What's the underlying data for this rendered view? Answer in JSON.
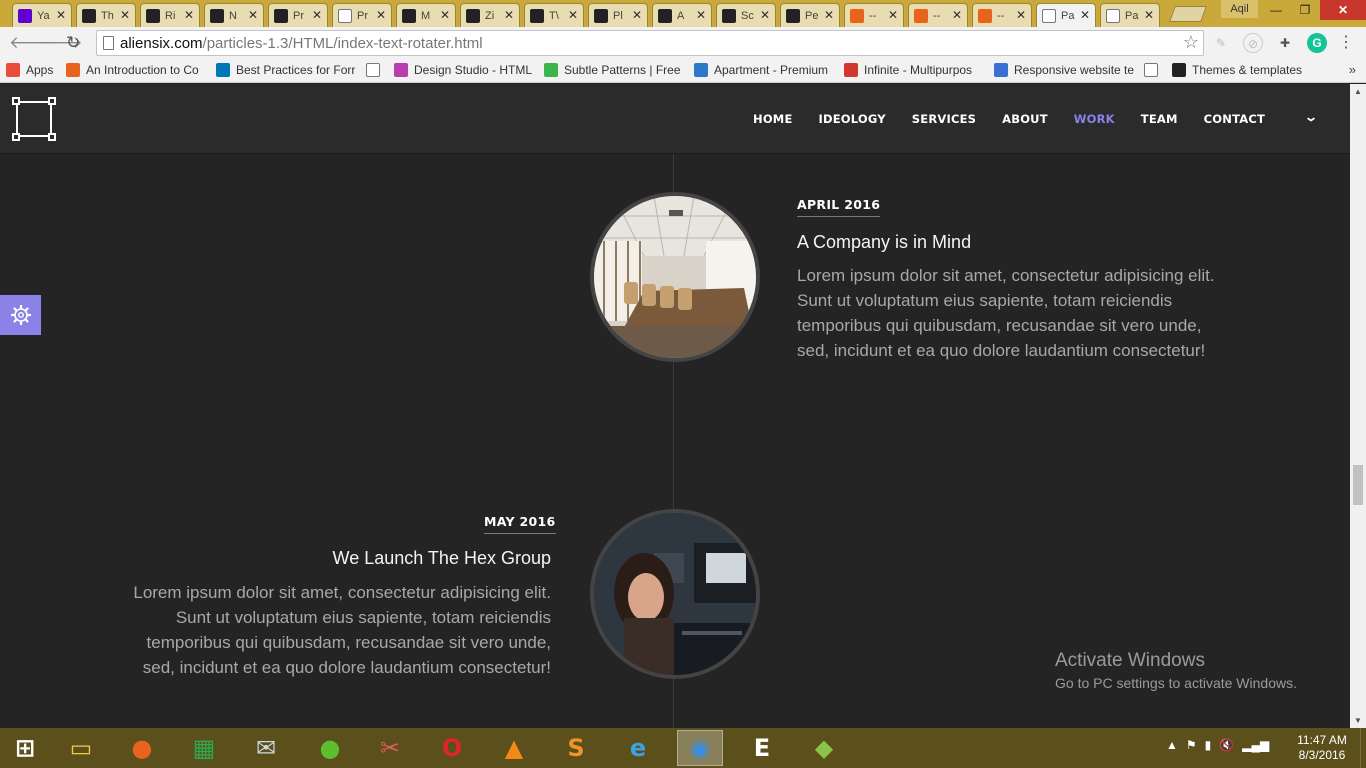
{
  "browser": {
    "tabs": [
      {
        "title": "Ya",
        "icon": "yahoo-icon",
        "color": "#5f01d1"
      },
      {
        "title": "Th",
        "icon": "w-icon",
        "color": "#222222"
      },
      {
        "title": "Ri",
        "icon": "w-icon",
        "color": "#222222"
      },
      {
        "title": "N",
        "icon": "w-icon",
        "color": "#222222"
      },
      {
        "title": "Pr",
        "icon": "w-icon",
        "color": "#222222"
      },
      {
        "title": "Pr",
        "icon": "page-icon",
        "color": "#ffffff"
      },
      {
        "title": "M",
        "icon": "w-icon",
        "color": "#222222"
      },
      {
        "title": "Zi",
        "icon": "w-icon",
        "color": "#222222"
      },
      {
        "title": "T\\",
        "icon": "w-icon",
        "color": "#222222"
      },
      {
        "title": "Pl",
        "icon": "w-icon",
        "color": "#222222"
      },
      {
        "title": "A",
        "icon": "w-icon",
        "color": "#222222"
      },
      {
        "title": "Sc",
        "icon": "w-icon",
        "color": "#222222"
      },
      {
        "title": "Pe",
        "icon": "w-icon",
        "color": "#222222"
      },
      {
        "title": "--",
        "icon": "m-icon",
        "color": "#e8641c"
      },
      {
        "title": "--",
        "icon": "m-icon",
        "color": "#e8641c"
      },
      {
        "title": "--",
        "icon": "m-icon",
        "color": "#e8641c"
      },
      {
        "title": "Pa",
        "icon": "page-icon",
        "color": "#ffffff",
        "active": true
      },
      {
        "title": "Pa",
        "icon": "page-icon",
        "color": "#ffffff"
      }
    ],
    "tab_close": "✕",
    "user_name": "Aqil",
    "window_min": "—",
    "window_max": "❐",
    "window_close": "✕",
    "url_host": "aliensix.com",
    "url_path": "/particles-1.3/HTML/index-text-rotater.html",
    "bookmarks": [
      {
        "label": "Apps",
        "icon": "apps-grid-icon",
        "color": "#e74c3c"
      },
      {
        "label": "An Introduction to Co",
        "icon": "plus-square-icon",
        "color": "#e8641c"
      },
      {
        "label": "Best Practices for Forr",
        "icon": "linkedin-icon",
        "color": "#0077b5"
      },
      {
        "label": "",
        "icon": "page-icon",
        "color": "#ffffff"
      },
      {
        "label": "Design Studio - HTML",
        "icon": "d-icon",
        "color": "#b63fb0"
      },
      {
        "label": "Subtle Patterns | Free",
        "icon": "pattern-icon",
        "color": "#3bb54a"
      },
      {
        "label": "Apartment - Premium",
        "icon": "house-icon",
        "color": "#2a7ac9"
      },
      {
        "label": "Infinite - Multipurpos",
        "icon": "wp-icon",
        "color": "#d0372f"
      },
      {
        "label": "Responsive website te",
        "icon": "shield-icon",
        "color": "#3b6fd6"
      },
      {
        "label": "",
        "icon": "page-icon",
        "color": "#ffffff"
      },
      {
        "label": "Themes & templates",
        "icon": "w-icon",
        "color": "#222222"
      }
    ],
    "bookmarks_more": "»"
  },
  "site": {
    "nav": [
      "HOME",
      "IDEOLOGY",
      "SERVICES",
      "ABOUT",
      "WORK",
      "TEAM",
      "CONTACT"
    ],
    "active_nav": "WORK",
    "accent": "#8a82e6",
    "timeline": [
      {
        "date": "APRIL 2016",
        "title": "A Company is in Mind",
        "body": "Lorem ipsum dolor sit amet, consectetur adipisicing elit. Sunt ut voluptatum eius sapiente, totam reiciendis temporibus qui quibusdam, recusandae sit vero unde, sed, incidunt et ea quo dolore laudantium consectetur!",
        "image": "conference-room"
      },
      {
        "date": "MAY 2016",
        "title": "We Launch The Hex Group",
        "body": "Lorem ipsum dolor sit amet, consectetur adipisicing elit. Sunt ut voluptatum eius sapiente, totam reiciendis temporibus qui quibusdam, recusandae sit vero unde, sed, incidunt et ea quo dolore laudantium consectetur!",
        "image": "woman-at-computer"
      }
    ]
  },
  "windows": {
    "activate_title": "Activate Windows",
    "activate_sub": "Go to PC settings to activate Windows.",
    "taskbar_apps": [
      "windows-start-icon",
      "file-explorer-icon",
      "firefox-icon",
      "store-icon",
      "email-icon",
      "frog-icon",
      "paint-icon",
      "opera-icon",
      "vlc-icon",
      "sublime-text-icon",
      "internet-explorer-icon",
      "chrome-icon",
      "e-app-icon",
      "bluestacks-icon"
    ],
    "time": "11:47 AM",
    "date": "8/3/2016"
  }
}
